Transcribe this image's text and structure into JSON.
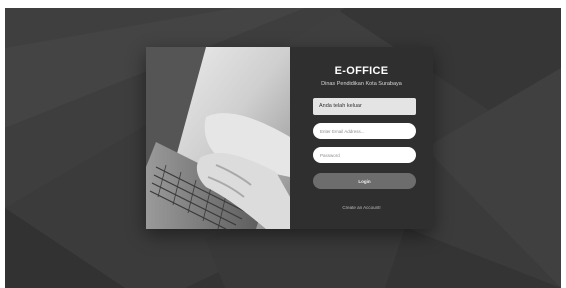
{
  "app": {
    "title": "E-OFFICE",
    "subtitle": "Dinas Pendidikan Kota Surabaya"
  },
  "alert": {
    "message": "Anda telah keluar"
  },
  "form": {
    "email_placeholder": "Enter Email Address...",
    "email_value": "",
    "password_placeholder": "Password",
    "password_value": "",
    "login_label": "Login"
  },
  "links": {
    "create_account": "Create an Account!"
  },
  "colors": {
    "background": "#3b3b3b",
    "panel": "#2f2f2f",
    "button": "#6d6d6d",
    "alert": "#e4e4e4"
  }
}
